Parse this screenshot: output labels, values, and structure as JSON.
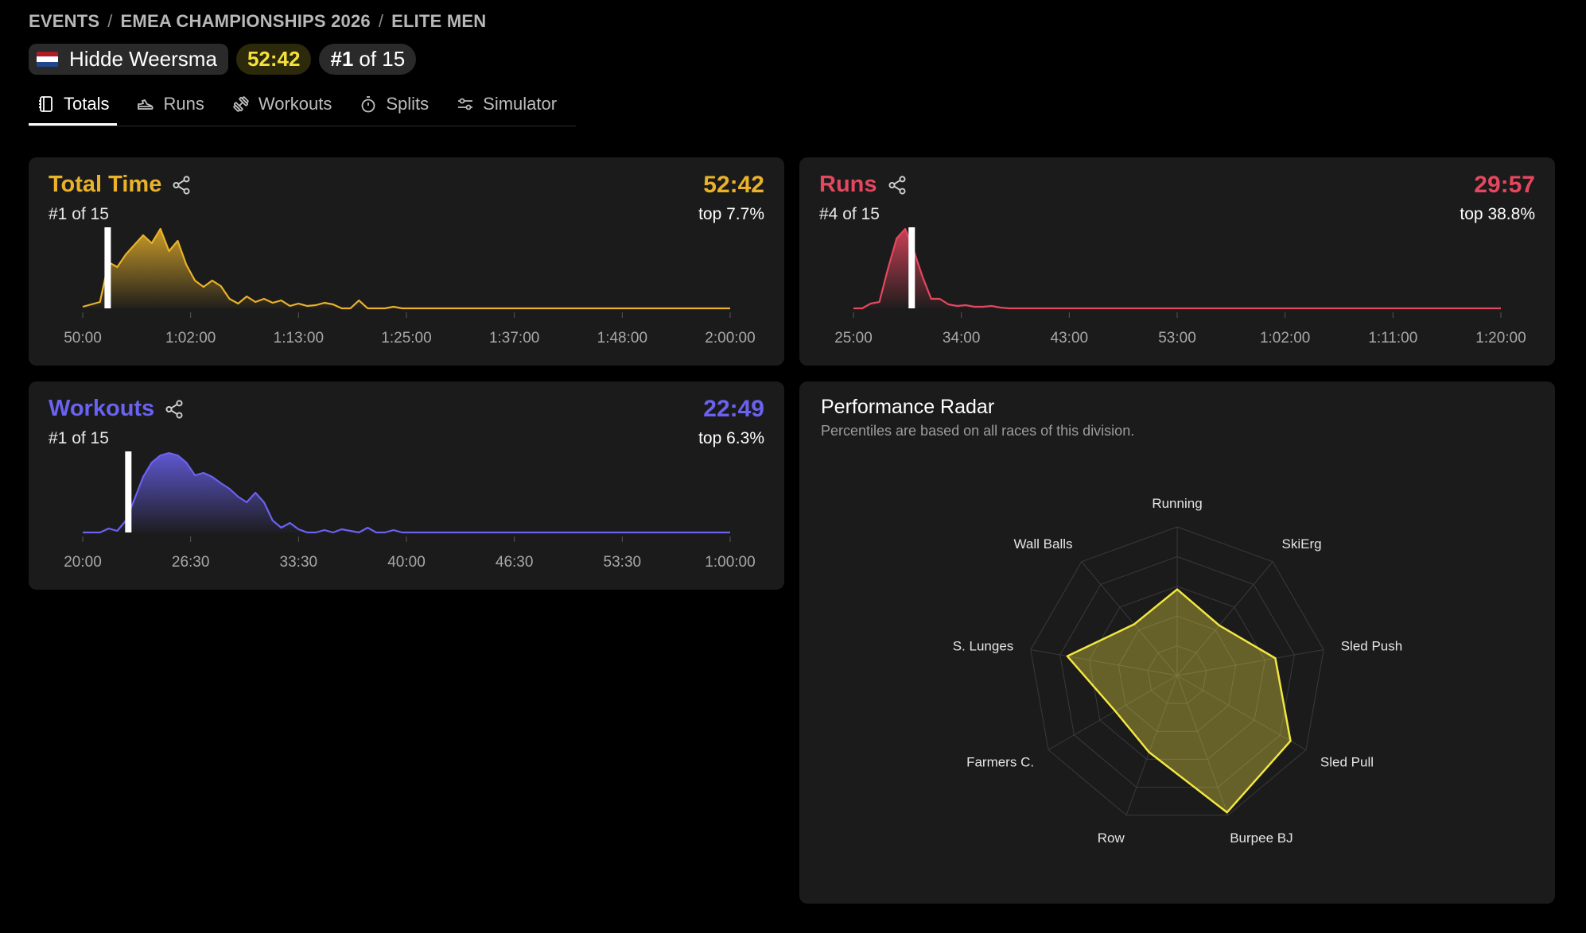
{
  "breadcrumb": [
    "EVENTS",
    "EMEA CHAMPIONSHIPS 2026",
    "ELITE MEN"
  ],
  "athlete": {
    "name": "Hidde Weersma",
    "flag_colors": [
      "#ae1c28",
      "#ffffff",
      "#21468b"
    ],
    "time": "52:42",
    "rank_bold": "#1",
    "rank_rest": "of 15"
  },
  "tabs": [
    {
      "label": "Totals",
      "icon": "notebook-icon",
      "active": true
    },
    {
      "label": "Runs",
      "icon": "shoe-icon",
      "active": false
    },
    {
      "label": "Workouts",
      "icon": "dumbbell-icon",
      "active": false
    },
    {
      "label": "Splits",
      "icon": "stopwatch-icon",
      "active": false
    },
    {
      "label": "Simulator",
      "icon": "sliders-icon",
      "active": false
    }
  ],
  "cards": {
    "total": {
      "title": "Total Time",
      "value": "52:42",
      "rank": "#1 of 15",
      "top": "top 7.7%",
      "color": "#e9b22a",
      "ticks": [
        "50:00",
        "1:02:00",
        "1:13:00",
        "1:25:00",
        "1:37:00",
        "1:48:00",
        "2:00:00"
      ]
    },
    "runs": {
      "title": "Runs",
      "value": "29:57",
      "rank": "#4 of 15",
      "top": "top 38.8%",
      "color": "#e5475f",
      "ticks": [
        "25:00",
        "34:00",
        "43:00",
        "53:00",
        "1:02:00",
        "1:11:00",
        "1:20:00"
      ]
    },
    "workouts": {
      "title": "Workouts",
      "value": "22:49",
      "rank": "#1 of 15",
      "top": "top 6.3%",
      "color": "#6a62f0",
      "ticks": [
        "20:00",
        "26:30",
        "33:30",
        "40:00",
        "46:30",
        "53:30",
        "1:00:00"
      ]
    }
  },
  "radar": {
    "title": "Performance Radar",
    "subtitle": "Percentiles are based on all races of this division.",
    "labels": [
      "Running",
      "SkiErg",
      "Sled Push",
      "Sled Pull",
      "Burpee BJ",
      "Row",
      "Farmers C.",
      "S. Lunges",
      "Wall Balls"
    ],
    "values": [
      0.58,
      0.44,
      0.67,
      0.88,
      0.98,
      0.55,
      0.48,
      0.75,
      0.45
    ],
    "color": "#f2e642"
  },
  "chart_data": [
    {
      "type": "area",
      "title": "Total Time",
      "xlabel": "",
      "ylabel": "",
      "x_range": [
        "50:00",
        "2:00:00"
      ],
      "athlete_marker": "52:42",
      "series": [
        {
          "values": [
            0.02,
            0.05,
            0.08,
            0.58,
            0.52,
            0.68,
            0.8,
            0.92,
            0.82,
            1.0,
            0.72,
            0.85,
            0.55,
            0.35,
            0.27,
            0.35,
            0.28,
            0.12,
            0.06,
            0.15,
            0.08,
            0.12,
            0.07,
            0.1,
            0.03,
            0.06,
            0.03,
            0.04,
            0.07,
            0.05,
            0.0,
            0.0,
            0.1,
            0.0,
            0.0,
            0.0,
            0.02,
            0.0,
            0.0,
            0.0,
            0.0,
            0.0,
            0.0,
            0.0,
            0.0,
            0.0,
            0.0,
            0.0,
            0.0,
            0.0,
            0.0,
            0.0,
            0.0,
            0.0,
            0.0,
            0.0,
            0.0,
            0.0,
            0.0,
            0.0,
            0.0,
            0.0,
            0.0,
            0.0,
            0.0,
            0.0,
            0.0,
            0.0,
            0.0,
            0.0,
            0.0,
            0.0,
            0.0,
            0.0,
            0.0,
            0.0
          ]
        }
      ]
    },
    {
      "type": "area",
      "title": "Runs",
      "xlabel": "",
      "ylabel": "",
      "x_range": [
        "25:00",
        "1:20:00"
      ],
      "athlete_marker": "29:57",
      "series": [
        {
          "values": [
            0.0,
            0.0,
            0.06,
            0.08,
            0.5,
            0.88,
            1.0,
            0.72,
            0.4,
            0.12,
            0.12,
            0.05,
            0.03,
            0.04,
            0.02,
            0.02,
            0.03,
            0.01,
            0.0,
            0.0,
            0.0,
            0.0,
            0.0,
            0.0,
            0.0,
            0.0,
            0.0,
            0.0,
            0.0,
            0.0,
            0.0,
            0.0,
            0.0,
            0.0,
            0.0,
            0.0,
            0.0,
            0.0,
            0.0,
            0.0,
            0.0,
            0.0,
            0.0,
            0.0,
            0.0,
            0.0,
            0.0,
            0.0,
            0.0,
            0.0,
            0.0,
            0.0,
            0.0,
            0.0,
            0.0,
            0.0,
            0.0,
            0.0,
            0.0,
            0.0,
            0.0,
            0.0,
            0.0,
            0.0,
            0.0,
            0.0,
            0.0,
            0.0,
            0.0,
            0.0,
            0.0,
            0.0,
            0.0,
            0.0,
            0.0,
            0.0
          ]
        }
      ]
    },
    {
      "type": "area",
      "title": "Workouts",
      "xlabel": "",
      "ylabel": "",
      "x_range": [
        "20:00",
        "1:00:00"
      ],
      "athlete_marker": "22:49",
      "series": [
        {
          "values": [
            0.0,
            0.0,
            0.0,
            0.05,
            0.02,
            0.15,
            0.42,
            0.7,
            0.88,
            0.97,
            1.0,
            0.97,
            0.88,
            0.72,
            0.75,
            0.7,
            0.62,
            0.55,
            0.45,
            0.38,
            0.5,
            0.38,
            0.15,
            0.06,
            0.12,
            0.04,
            0.0,
            0.0,
            0.03,
            0.0,
            0.04,
            0.02,
            0.0,
            0.06,
            0.0,
            0.0,
            0.03,
            0.0,
            0.0,
            0.0,
            0.0,
            0.0,
            0.0,
            0.0,
            0.0,
            0.0,
            0.0,
            0.0,
            0.0,
            0.0,
            0.0,
            0.0,
            0.0,
            0.0,
            0.0,
            0.0,
            0.0,
            0.0,
            0.0,
            0.0,
            0.0,
            0.0,
            0.0,
            0.0,
            0.0,
            0.0,
            0.0,
            0.0,
            0.0,
            0.0,
            0.0,
            0.0,
            0.0,
            0.0,
            0.0,
            0.0
          ]
        }
      ]
    }
  ]
}
